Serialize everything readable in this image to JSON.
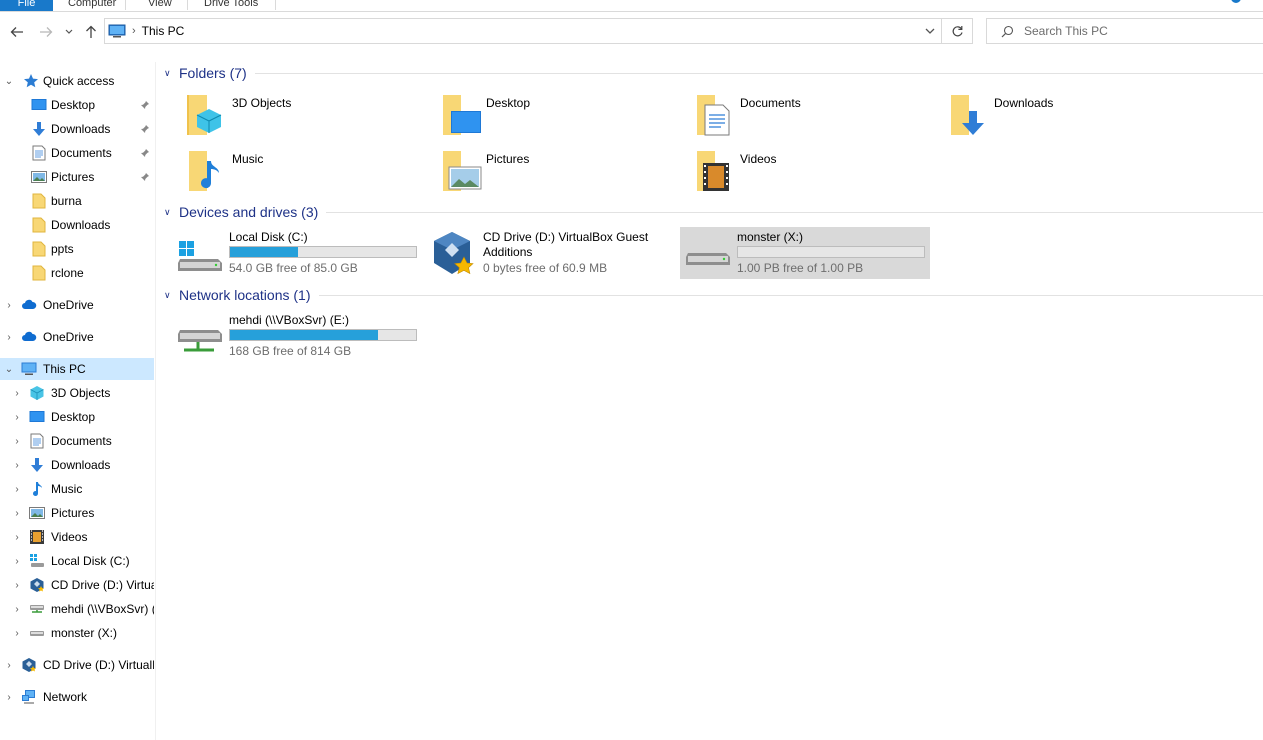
{
  "ribbon": {
    "tabs": [
      "File",
      "Computer",
      "View",
      "Drive Tools"
    ]
  },
  "address": {
    "location": "This PC",
    "search_placeholder": "Search This PC"
  },
  "sidebar": {
    "items": [
      {
        "label": "Quick access",
        "icon": "star-icon"
      },
      {
        "label": "Desktop",
        "icon": "desktop-icon",
        "pinned": true
      },
      {
        "label": "Downloads",
        "icon": "download-arrow-icon",
        "pinned": true
      },
      {
        "label": "Documents",
        "icon": "documents-icon",
        "pinned": true
      },
      {
        "label": "Pictures",
        "icon": "pictures-icon",
        "pinned": true
      },
      {
        "label": "burna",
        "icon": "folder-icon"
      },
      {
        "label": "Downloads",
        "icon": "folder-icon"
      },
      {
        "label": "ppts",
        "icon": "folder-icon"
      },
      {
        "label": "rclone",
        "icon": "folder-icon"
      },
      {
        "label": "OneDrive",
        "icon": "cloud-icon"
      },
      {
        "label": "OneDrive",
        "icon": "cloud-icon"
      },
      {
        "label": "This PC",
        "icon": "computer-icon"
      },
      {
        "label": "3D Objects",
        "icon": "cube-icon"
      },
      {
        "label": "Desktop",
        "icon": "desktop-icon"
      },
      {
        "label": "Documents",
        "icon": "documents-icon"
      },
      {
        "label": "Downloads",
        "icon": "download-arrow-icon"
      },
      {
        "label": "Music",
        "icon": "music-note-icon"
      },
      {
        "label": "Pictures",
        "icon": "pictures-icon"
      },
      {
        "label": "Videos",
        "icon": "film-icon"
      },
      {
        "label": "Local Disk (C:)",
        "icon": "windows-drive-icon"
      },
      {
        "label": "CD Drive (D:) VirtualBox Guest Additions",
        "icon": "virtualbox-icon"
      },
      {
        "label": "mehdi (\\\\VBoxSvr) (E:)",
        "icon": "network-drive-icon"
      },
      {
        "label": "monster (X:)",
        "icon": "drive-icon"
      },
      {
        "label": "CD Drive (D:) VirtualBox Guest Additions",
        "icon": "virtualbox-icon"
      },
      {
        "label": "Network",
        "icon": "network-icon"
      }
    ]
  },
  "groups": {
    "folders": "Folders (7)",
    "devices": "Devices and drives (3)",
    "network": "Network locations (1)"
  },
  "folders": [
    {
      "label": "3D Objects",
      "icon": "3d-objects-folder-icon"
    },
    {
      "label": "Desktop",
      "icon": "desktop-folder-icon"
    },
    {
      "label": "Documents",
      "icon": "documents-folder-icon"
    },
    {
      "label": "Downloads",
      "icon": "downloads-folder-icon"
    },
    {
      "label": "Music",
      "icon": "music-folder-icon"
    },
    {
      "label": "Pictures",
      "icon": "pictures-folder-icon"
    },
    {
      "label": "Videos",
      "icon": "videos-folder-icon"
    }
  ],
  "drives": [
    {
      "name": "Local Disk (C:)",
      "free": "54.0 GB free of 85.0 GB",
      "used_fraction": 0.365
    },
    {
      "name": "CD Drive (D:) VirtualBox Guest Additions",
      "free": "0 bytes free of 60.9 MB",
      "used_fraction": 1.0
    },
    {
      "name": "monster (X:)",
      "free": "1.00 PB free of 1.00 PB",
      "used_fraction": 0.0
    }
  ],
  "network_locations": [
    {
      "name": "mehdi (\\\\VBoxSvr) (E:)",
      "free": "168 GB free of 814 GB",
      "used_fraction": 0.794
    }
  ],
  "colors": {
    "accent": "#1979ca",
    "selection": "#cce8ff",
    "group_header": "#1e3287",
    "bar_fill": "#26a0da",
    "drive_selected": "#d9d9d9"
  }
}
